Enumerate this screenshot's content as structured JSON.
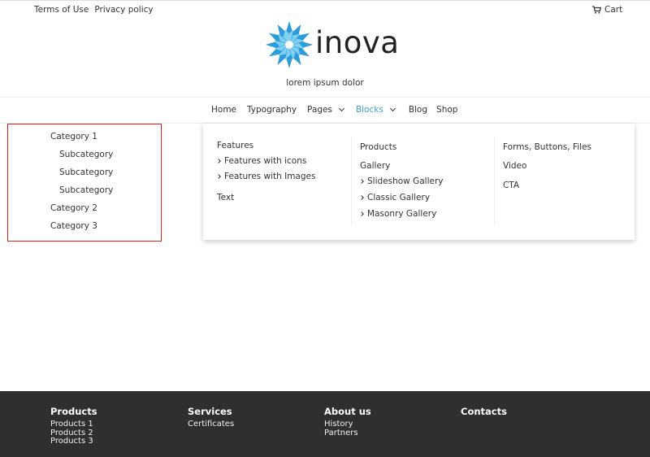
{
  "topbar": {
    "links": [
      "Terms of Use",
      "Privacy policy"
    ],
    "cart_label": "Cart"
  },
  "brand": {
    "name": "inova",
    "tagline": "lorem ipsum dolor",
    "logo_colors": [
      "#2d9ad9",
      "#7fd0f2"
    ]
  },
  "nav": {
    "items": [
      {
        "label": "Home"
      },
      {
        "label": "Typography"
      },
      {
        "label": "Pages"
      },
      {
        "label": "Blocks"
      },
      {
        "label": "Blog"
      },
      {
        "label": "Shop"
      }
    ],
    "active_color": "#3aa5d8"
  },
  "categories": {
    "items": [
      {
        "label": "Category 1"
      },
      {
        "label": "Subcategory"
      },
      {
        "label": "Subcategory"
      },
      {
        "label": "Subcategory"
      },
      {
        "label": "Category 2"
      },
      {
        "label": "Category 3"
      }
    ],
    "highlight_color": "#d32020"
  },
  "mega_menu": {
    "col1": [
      "Features",
      "Features with icons",
      "Features with Images",
      "Text"
    ],
    "col2": [
      "Products",
      "Gallery",
      "Slideshow Gallery",
      "Classic Gallery",
      "Masonry Gallery"
    ],
    "col3": [
      "Forms, Buttons, Files",
      "Video",
      "CTA"
    ]
  },
  "footer": {
    "columns": [
      {
        "heading": "Products",
        "links": [
          "Products 1",
          "Products 2",
          "Products 3"
        ]
      },
      {
        "heading": "Services",
        "links": [
          "Certificates"
        ]
      },
      {
        "heading": "About us",
        "links": [
          "History",
          "Partners"
        ]
      },
      {
        "heading": "Contacts",
        "links": []
      }
    ],
    "background": "#2f2f2f"
  }
}
